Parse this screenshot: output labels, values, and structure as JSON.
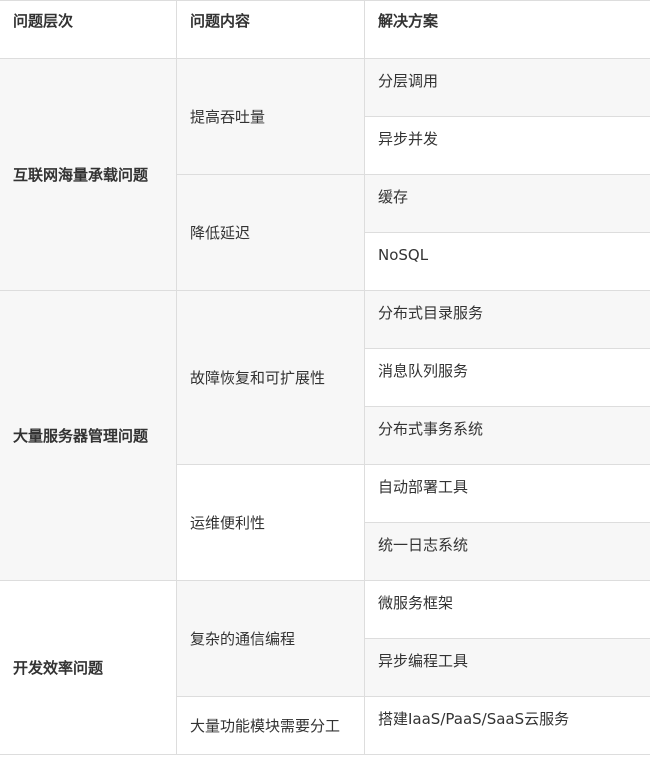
{
  "headers": [
    "问题层次",
    "问题内容",
    "解决方案"
  ],
  "groups": [
    {
      "level": "互联网海量承载问题",
      "issues": [
        {
          "content": "提高吞吐量",
          "solutions": [
            "分层调用",
            "异步并发"
          ]
        },
        {
          "content": "降低延迟",
          "solutions": [
            "缓存",
            "NoSQL"
          ]
        }
      ]
    },
    {
      "level": "大量服务器管理问题",
      "issues": [
        {
          "content": "故障恢复和可扩展性",
          "solutions": [
            "分布式目录服务",
            "消息队列服务",
            "分布式事务系统"
          ]
        },
        {
          "content": "运维便利性",
          "solutions": [
            "自动部署工具",
            "统一日志系统"
          ]
        }
      ]
    },
    {
      "level": "开发效率问题",
      "issues": [
        {
          "content": "复杂的通信编程",
          "solutions": [
            "微服务框架",
            "异步编程工具"
          ]
        },
        {
          "content": "大量功能模块需要分工",
          "solutions": [
            "搭建IaaS/PaaS/SaaS云服务"
          ]
        }
      ]
    }
  ]
}
